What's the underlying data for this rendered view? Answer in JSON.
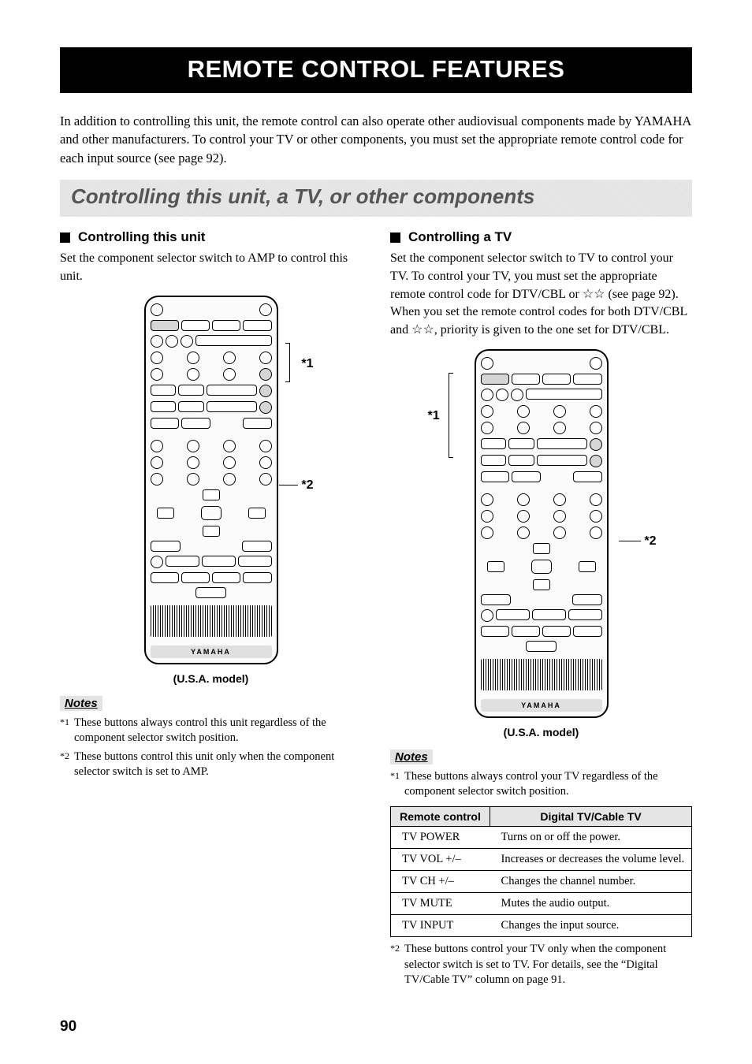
{
  "title": "REMOTE CONTROL FEATURES",
  "intro": "In addition to controlling this unit, the remote control can also operate other audiovisual components made by YAMAHA and other manufacturers. To control your TV or other components, you must set the appropriate remote control code for each input source (see page 92).",
  "section_band": "Controlling this unit, a TV, or other components",
  "left": {
    "heading": "Controlling this unit",
    "body": "Set the component selector switch to AMP to control this unit.",
    "model_label": "(U.S.A. model)",
    "callouts": {
      "c1": "*1",
      "c2": "*2"
    },
    "notes_heading": "Notes",
    "notes": [
      {
        "mark": "*1",
        "text": "These buttons always control this unit regardless of the component selector switch position."
      },
      {
        "mark": "*2",
        "text": "These buttons control this unit only when the component selector switch is set to AMP."
      }
    ]
  },
  "right": {
    "heading": "Controlling a TV",
    "body": "Set the component selector switch to TV to control your TV. To control your TV, you must set the appropriate remote control code for DTV/CBL or ☆☆ (see page 92). When you set the remote control codes for both DTV/CBL and ☆☆, priority is given to the one set for DTV/CBL.",
    "model_label": "(U.S.A. model)",
    "callouts": {
      "c1": "*1",
      "c2": "*2"
    },
    "notes_heading": "Notes",
    "note_before_table": {
      "mark": "*1",
      "text": "These buttons always control your TV regardless of the component selector switch position."
    },
    "table": {
      "headers": [
        "Remote control",
        "Digital TV/Cable TV"
      ],
      "rows": [
        [
          "TV POWER",
          "Turns on or off the power."
        ],
        [
          "TV VOL +/–",
          "Increases or decreases the volume level."
        ],
        [
          "TV CH +/–",
          "Changes the channel number."
        ],
        [
          "TV MUTE",
          "Mutes the audio output."
        ],
        [
          "TV INPUT",
          "Changes the input source."
        ]
      ]
    },
    "note_after_table": {
      "mark": "*2",
      "text": "These buttons control your TV only when the component selector switch is set to TV. For details, see the “Digital TV/Cable TV” column on page 91."
    }
  },
  "remote_brand": "YAMAHA",
  "page_number": "90"
}
